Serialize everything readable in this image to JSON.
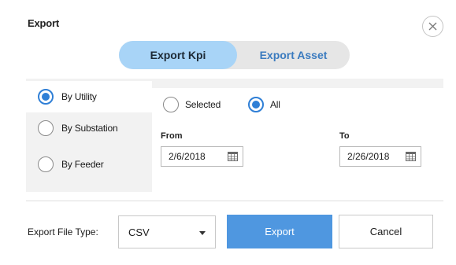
{
  "dialog": {
    "title": "Export",
    "close_icon": "close-icon"
  },
  "tabs": [
    {
      "label": "Export Kpi",
      "active": true
    },
    {
      "label": "Export Asset",
      "active": false
    }
  ],
  "scope_options": [
    {
      "label": "By Utility",
      "selected": true
    },
    {
      "label": "By Substation",
      "selected": false
    },
    {
      "label": "By Feeder",
      "selected": false
    }
  ],
  "selection_options": [
    {
      "label": "Selected",
      "selected": false
    },
    {
      "label": "All",
      "selected": true
    }
  ],
  "from": {
    "label": "From",
    "value": "2/6/2018",
    "icon": "calendar-icon"
  },
  "to": {
    "label": "To",
    "value": "2/26/2018",
    "icon": "calendar-icon"
  },
  "footer": {
    "file_type_label": "Export File Type:",
    "file_type_value": "CSV",
    "export_label": "Export",
    "cancel_label": "Cancel"
  },
  "colors": {
    "accent": "#2f7fd6",
    "tab_active_bg": "#a8d4f7",
    "tab_inactive_text": "#3b7bbf",
    "export_button_bg": "#4f97e0",
    "panel_bg": "#f2f2f2"
  }
}
